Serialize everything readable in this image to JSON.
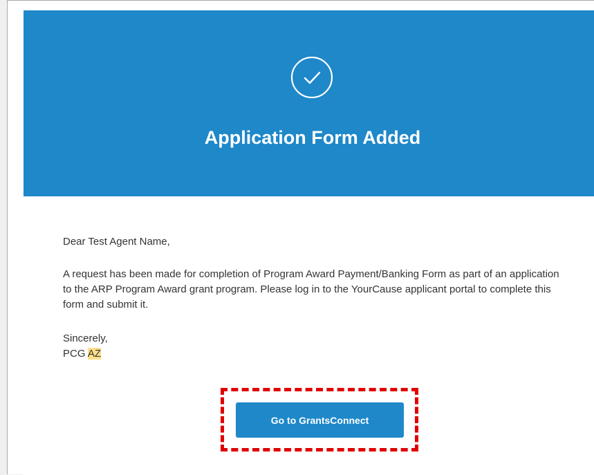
{
  "banner": {
    "icon": "check-circle-icon",
    "title": "Application Form Added",
    "color": "#1e88c9"
  },
  "message": {
    "greeting": "Dear Test Agent Name,",
    "paragraph": "A request has been made for completion of Program Award Payment/Banking Form as part of an application to the ARP Program Award grant program. Please log in to the YourCause applicant portal to complete this form and submit it.",
    "closing": "Sincerely,",
    "signature_name": "PCG",
    "signature_highlight": "AZ"
  },
  "cta": {
    "label": "Go to GrantsConnect",
    "color": "#1e88c9",
    "annotation_color": "#e00000"
  }
}
